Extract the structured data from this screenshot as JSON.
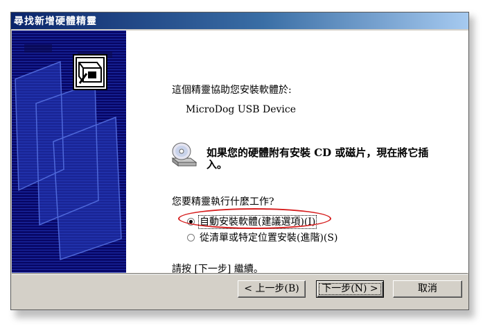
{
  "window": {
    "title": "尋找新增硬體精靈"
  },
  "content": {
    "intro": "這個精靈協助您安裝軟體於:",
    "device_name": "MicroDog USB Device",
    "cd_message": "如果您的硬體附有安裝 CD 或磁片，現在將它插入。",
    "question": "您要精靈執行什麼工作?",
    "options": [
      {
        "label": "自動安裝軟體(建議選項)(I)",
        "checked": true
      },
      {
        "label": "從清單或特定位置安裝(進階)(S)",
        "checked": false
      }
    ],
    "continue_text": "請按 [下一步] 繼續。"
  },
  "buttons": {
    "back": "< 上一步(B)",
    "next": "下一步(N) >",
    "cancel": "取消"
  },
  "colors": {
    "side_panel": "#080868",
    "highlight_ellipse": "#d61e1e",
    "dialog_face": "#d4d0c8"
  },
  "icons": {
    "wizard": "hardware-wizard-icon",
    "cd": "cd-drive-icon"
  }
}
